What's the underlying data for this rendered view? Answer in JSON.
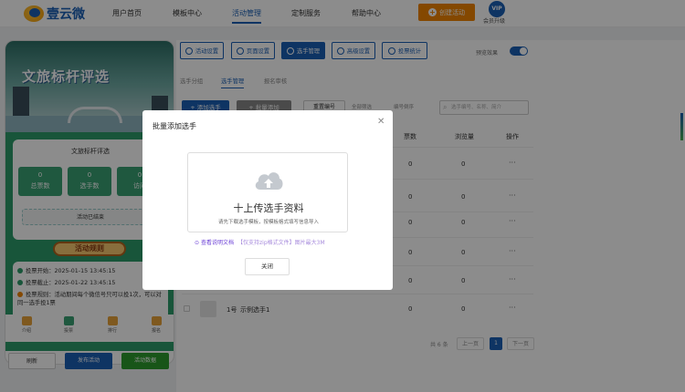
{
  "header": {
    "logo_text": "壹云微",
    "menu": [
      "用户首页",
      "模板中心",
      "活动管理",
      "定制服务",
      "帮助中心"
    ],
    "create_label": "创建活动",
    "vip_badge": "VIP",
    "vip_label": "会员升级"
  },
  "preview": {
    "banner_title": "文旅标杆评选",
    "card_title": "文旅标杆评选",
    "stats": [
      {
        "value": "0",
        "label": "总票数"
      },
      {
        "value": "0",
        "label": "选手数"
      },
      {
        "value": "0",
        "label": "访问"
      }
    ],
    "ended_text": "活动已结束",
    "rules_title": "活动规则",
    "rules": [
      "投票开始：2025-01-15 13:45:15",
      "投票截止：2025-01-22 13:45:15",
      "投票规则：活动期间每个微信号只可以投1次，可以对同一选手投1票"
    ],
    "tabbar": [
      "介绍",
      "投票",
      "排行",
      "报名"
    ],
    "buttons": {
      "refresh": "刷新",
      "publish": "发布活动",
      "data": "活动数据"
    }
  },
  "toolbar": {
    "tools": [
      "活动设置",
      "页面设置",
      "选手管理",
      "高级设置",
      "投票统计"
    ],
    "preview_label": "预览效果"
  },
  "subtabs": [
    "选手分组",
    "选手管理",
    "报名审核"
  ],
  "actions": {
    "add": "+ 添加选手",
    "batch": "+ 批量添加",
    "reset": "重置编号",
    "filter_all": "全部筛选",
    "sort": "编号倒序",
    "search_placeholder": "选手编号、名称、简介"
  },
  "table": {
    "columns": [
      "票数",
      "浏览量",
      "操作"
    ],
    "rows": [
      {
        "votes": "0",
        "views": "0"
      },
      {
        "votes": "0",
        "views": "0"
      },
      {
        "votes": "0",
        "views": "0"
      },
      {
        "votes": "0",
        "views": "0"
      },
      {
        "votes": "0",
        "views": "0"
      },
      {
        "votes": "0",
        "views": "0",
        "no": "1号",
        "name": "示例选手1"
      }
    ],
    "more": "···"
  },
  "pagination": {
    "total": "共 6 条",
    "prev": "上一页",
    "current": "1",
    "next": "下一页"
  },
  "modal": {
    "title": "批量添加选手",
    "upload_title": "十上传选手资料",
    "upload_hint": "请先下载选手模板，按模板格式填写信息导入",
    "doc_link": "查看说明文档",
    "doc_note": "【仅支持zip格式文件】图片最大3M",
    "close": "关闭"
  },
  "colors": {
    "primary": "#1a5fb4",
    "accent": "#f08300",
    "green": "#2d9b6a",
    "purple": "#6b3fd6"
  }
}
